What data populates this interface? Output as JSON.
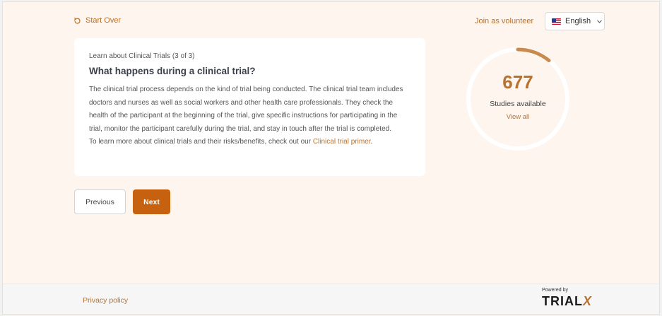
{
  "header": {
    "start_over": "Start Over",
    "join_volunteer": "Join as volunteer",
    "language": "English"
  },
  "card": {
    "breadcrumb": "Learn about Clinical Trials (3 of 3)",
    "title": "What happens during a clinical trial?",
    "paragraph": "The clinical trial process depends on the kind of trial being conducted. The clinical trial team includes doctors and nurses as well as social workers and other health care professionals. They check the health of the participant at the beginning of the trial, give specific instructions for participating in the trial, monitor the participant carefully during the trial, and stay in touch after the trial is completed.",
    "learn_more_prefix": "To learn more about clinical trials and their risks/benefits, check out our ",
    "learn_more_link": "Clinical trial primer",
    "learn_more_suffix": "."
  },
  "nav": {
    "previous": "Previous",
    "next": "Next"
  },
  "studies": {
    "count": "677",
    "label": "Studies available",
    "view_all": "View all"
  },
  "footer": {
    "privacy": "Privacy policy",
    "powered_by": "Powered by",
    "brand_main": "TRIAL",
    "brand_x": "X"
  },
  "colors": {
    "accent": "#b8722f",
    "primary_button": "#c6620f",
    "background": "#fdf5ee"
  },
  "icons": [
    "refresh-icon",
    "us-flag-icon",
    "chevron-down-icon"
  ]
}
